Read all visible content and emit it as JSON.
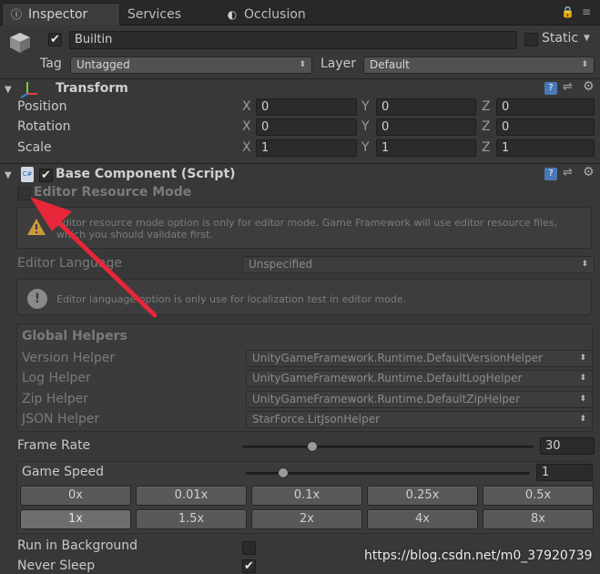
{
  "tabs": [
    {
      "label": "Inspector",
      "icon": "info-icon"
    },
    {
      "label": "Services",
      "icon": "cloud-icon"
    },
    {
      "label": "Occlusion",
      "icon": "eye-icon"
    }
  ],
  "gameobject": {
    "active": true,
    "name": "Builtin",
    "static_label": "Static",
    "tag_label": "Tag",
    "tag_value": "Untagged",
    "layer_label": "Layer",
    "layer_value": "Default"
  },
  "transform": {
    "title": "Transform",
    "rows": [
      {
        "label": "Position",
        "x": "0",
        "y": "0",
        "z": "0"
      },
      {
        "label": "Rotation",
        "x": "0",
        "y": "0",
        "z": "0"
      },
      {
        "label": "Scale",
        "x": "1",
        "y": "1",
        "z": "1"
      }
    ],
    "axis": {
      "x": "X",
      "y": "Y",
      "z": "Z"
    }
  },
  "base_component": {
    "title": "Base Component (Script)",
    "editor_resource_mode_label": "Editor Resource Mode",
    "resource_help_line1": "Editor resource mode option is only for editor mode. Game Framework will use editor resource files,",
    "resource_help_line2": "which you should validate first.",
    "editor_language_label": "Editor Language",
    "editor_language_value": "Unspecified",
    "language_help": "Editor language option is only use for localization test in editor mode.",
    "global_helpers_title": "Global Helpers",
    "helpers": [
      {
        "label": "Version Helper",
        "value": "UnityGameFramework.Runtime.DefaultVersionHelper"
      },
      {
        "label": "Log Helper",
        "value": "UnityGameFramework.Runtime.DefaultLogHelper"
      },
      {
        "label": "Zip Helper",
        "value": "UnityGameFramework.Runtime.DefaultZipHelper"
      },
      {
        "label": "JSON Helper",
        "value": "StarForce.LitJsonHelper"
      }
    ],
    "frame_rate_label": "Frame Rate",
    "frame_rate_value": "30",
    "frame_rate_fraction": 0.24,
    "game_speed_label": "Game Speed",
    "game_speed_value": "1",
    "game_speed_fraction": 0.13,
    "speed_buttons_row1": [
      "0x",
      "0.01x",
      "0.1x",
      "0.25x",
      "0.5x"
    ],
    "speed_buttons_row2": [
      "1x",
      "1.5x",
      "2x",
      "4x",
      "8x"
    ],
    "active_speed": "1x",
    "run_in_background_label": "Run in Background",
    "run_in_background": false,
    "never_sleep_label": "Never Sleep",
    "never_sleep": true
  },
  "watermark": "https://blog.csdn.net/m0_37920739",
  "colors": {
    "arrow": "#e8263a",
    "background": "#383838"
  }
}
